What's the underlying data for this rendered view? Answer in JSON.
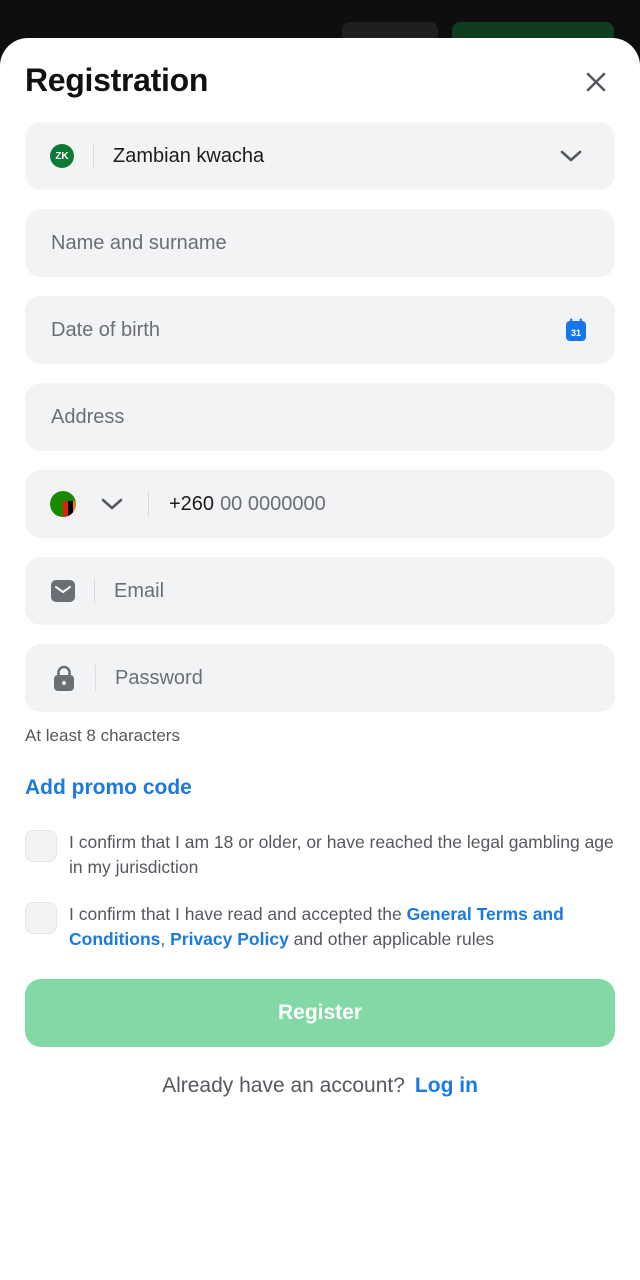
{
  "header": {
    "title": "Registration"
  },
  "currency": {
    "badge": "ZK",
    "value": "Zambian kwacha"
  },
  "fields": {
    "name_placeholder": "Name and surname",
    "dob_placeholder": "Date of birth",
    "calendar_day": "31",
    "address_placeholder": "Address",
    "phone_prefix": "+260",
    "phone_placeholder": "00 0000000",
    "email_placeholder": "Email",
    "password_placeholder": "Password",
    "password_hint": "At least 8 characters"
  },
  "promo": {
    "label": "Add promo code"
  },
  "consents": {
    "age": "I confirm that I am 18 or older, or have reached the legal gambling age in my jurisdiction",
    "terms_prefix": "I confirm that I have read and accepted the ",
    "terms_link": "General Terms and Conditions",
    "terms_sep": ", ",
    "privacy_link": "Privacy Policy",
    "terms_suffix": " and other applicable rules"
  },
  "actions": {
    "register_label": "Register",
    "login_prompt": "Already have an account?",
    "login_link": "Log in"
  },
  "colors": {
    "accent": "#1a7ae0",
    "register_bg": "#82d9a5",
    "field_bg": "#f2f3f5",
    "calendar_blue": "#1677e8"
  }
}
